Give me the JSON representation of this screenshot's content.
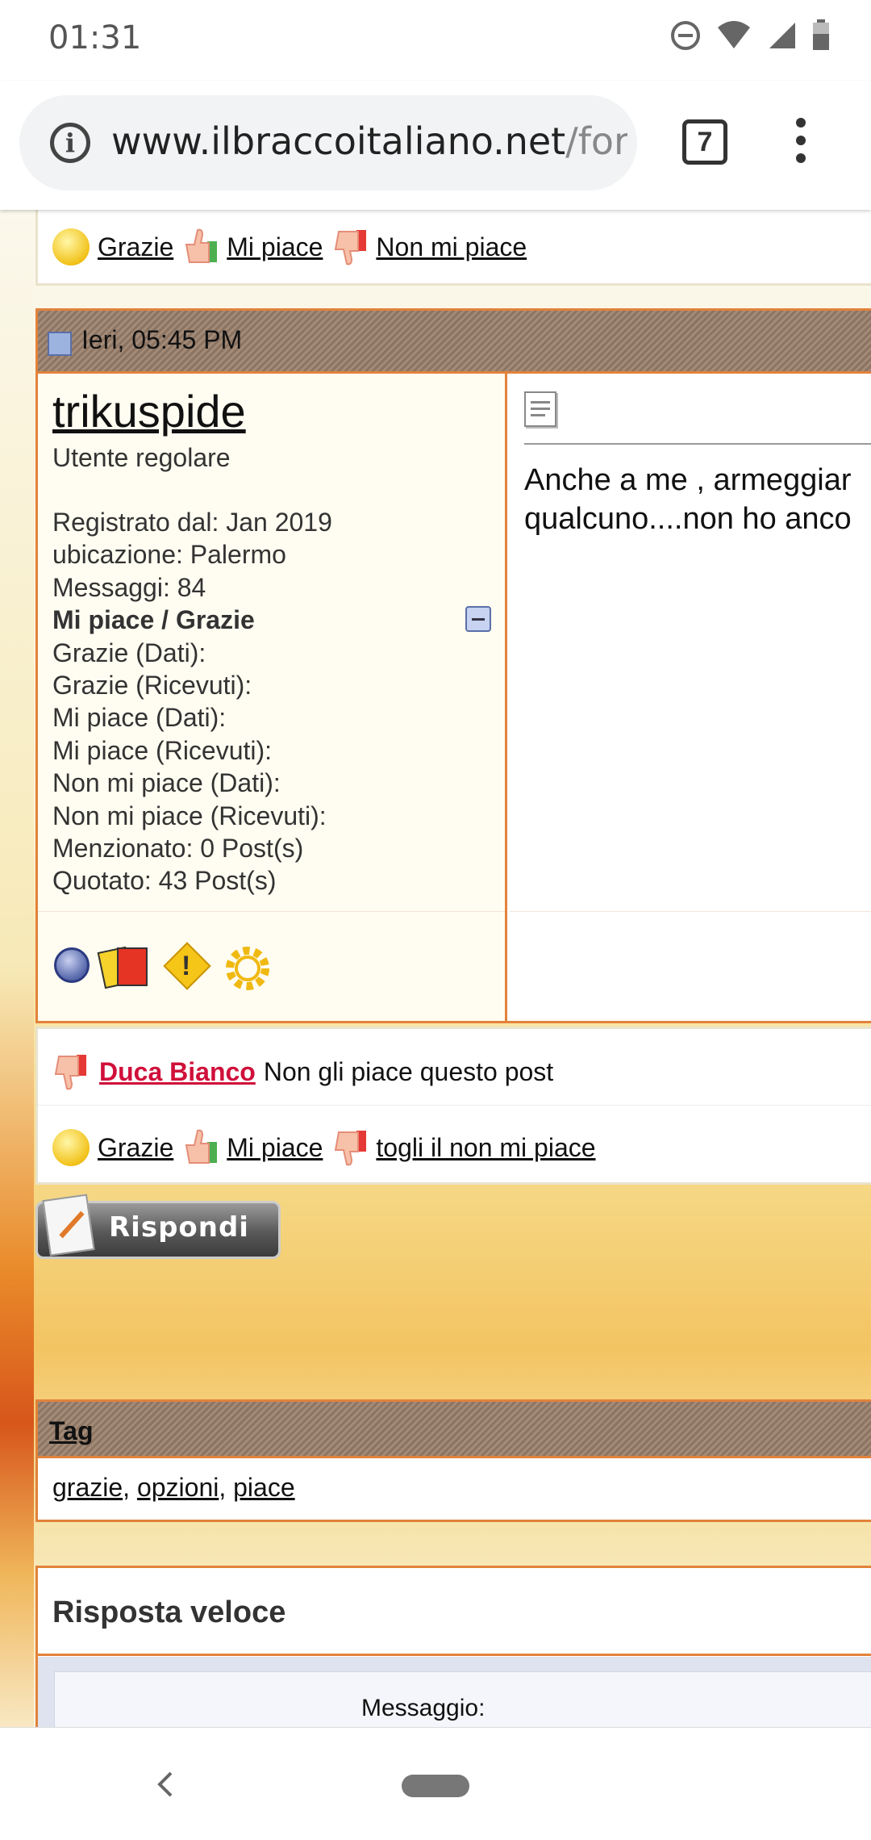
{
  "status": {
    "time": "01:31"
  },
  "browser": {
    "url_host": "www.ilbraccoitaliano.net",
    "url_rest": "/foru",
    "tab_count": "7"
  },
  "reactions_top": {
    "grazie": "Grazie",
    "mi_piace": "Mi piace",
    "non_mi_piace": "Non mi piace"
  },
  "post": {
    "date": "Ieri, 05:45 PM",
    "username": "trikuspide",
    "role": "Utente regolare",
    "registered": "Registrato dal: Jan 2019",
    "location": "ubicazione: Palermo",
    "messages": "Messaggi: 84",
    "likes_header": "Mi piace / Grazie",
    "stats": [
      "Grazie (Dati):",
      "Grazie (Ricevuti):",
      "Mi piace (Dati):",
      "Mi piace (Ricevuti):",
      "Non mi piace (Dati):",
      "Non mi piace (Ricevuti):",
      "Menzionato: 0 Post(s)",
      "Quotato: 43 Post(s)"
    ],
    "body_line1": "Anche a me , armeggiar",
    "body_line2": "qualcuno....non ho anco"
  },
  "dislike_notice": {
    "user": "Duca Bianco",
    "text": "Non gli piace questo post"
  },
  "reactions_bottom": {
    "grazie": "Grazie",
    "mi_piace": "Mi piace",
    "togli": "togli il non mi piace"
  },
  "reply_button": "Rispondi",
  "tags": {
    "header": "Tag",
    "items": [
      "grazie",
      "opzioni",
      "piace"
    ]
  },
  "quick_reply": {
    "title": "Risposta veloce",
    "message_label": "Messaggio:"
  },
  "colors": {
    "accent_orange": "#e2823a",
    "tag_header": "#9b8471",
    "link_red": "#d0103a"
  }
}
